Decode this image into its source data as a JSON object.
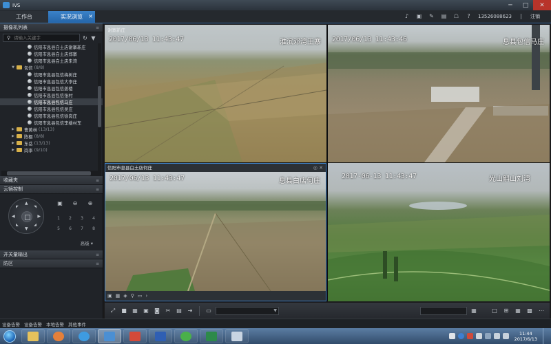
{
  "app": {
    "name": "IVS",
    "win_min": "─",
    "win_max": "□",
    "win_close": "✕"
  },
  "tabs": {
    "home": "工作台",
    "live": "实况浏览",
    "close": "×"
  },
  "user": {
    "phone": "13526088623",
    "logout": "注销"
  },
  "toolbar_icons": [
    "speaker-icon",
    "monitor-icon",
    "wrench-icon",
    "lock-icon",
    "network-icon",
    "help-icon"
  ],
  "left": {
    "camera_list_title": "摄像机列表",
    "search_placeholder": "请输入关键字",
    "tree": [
      {
        "kind": "cam",
        "indent": 3,
        "label": "信阳市息县白土店谢寨新庄"
      },
      {
        "kind": "cam",
        "indent": 3,
        "label": "信阳市息县白土店郑寨"
      },
      {
        "kind": "cam",
        "indent": 3,
        "label": "信阳市息县白土店朱湾"
      },
      {
        "kind": "folder",
        "indent": 1,
        "label": "包信",
        "count": "(8/8)",
        "open": true
      },
      {
        "kind": "cam",
        "indent": 3,
        "label": "信阳市息县包信梅树庄"
      },
      {
        "kind": "cam",
        "indent": 3,
        "label": "信阳市息县包信大李庄"
      },
      {
        "kind": "cam",
        "indent": 3,
        "label": "信阳市息县包信姜楼"
      },
      {
        "kind": "cam",
        "indent": 3,
        "label": "信阳市息县包信张村"
      },
      {
        "kind": "cam",
        "indent": 3,
        "label": "信阳市息县包信马庄",
        "selected": true
      },
      {
        "kind": "cam",
        "indent": 3,
        "label": "信阳市息县包信吴庄"
      },
      {
        "kind": "cam",
        "indent": 3,
        "label": "信阳市息县包信徐岗庄"
      },
      {
        "kind": "cam",
        "indent": 3,
        "label": "信阳市息县包信李楼村东"
      },
      {
        "kind": "folder",
        "indent": 1,
        "label": "曹黄林",
        "count": "(13/13)",
        "open": false
      },
      {
        "kind": "folder",
        "indent": 1,
        "label": "陈棚",
        "count": "(8/8)",
        "open": false
      },
      {
        "kind": "folder",
        "indent": 1,
        "label": "东岳",
        "count": "(13/13)",
        "open": false
      },
      {
        "kind": "folder",
        "indent": 1,
        "label": "岗李",
        "count": "(9/10)",
        "open": false
      }
    ],
    "favorites_title": "收藏夹",
    "ptz_title": "云镜控制",
    "ptz_numbers": [
      "1",
      "2",
      "3",
      "4",
      "5",
      "6",
      "7",
      "8"
    ],
    "ptz_advanced": "高级",
    "switch_output_title": "开关量输出",
    "defense_title": "防区"
  },
  "videos": {
    "c1": {
      "small": "谢寨新庄",
      "date": "2017/06/13 11:43:47",
      "place": "淮滨邓湾王寨"
    },
    "c2": {
      "date": "2017/06/13 11:43:46",
      "place": "息县包信马庄"
    },
    "c3": {
      "header": "信阳市息县白土店何庄",
      "date": "2017/06/13 11:43:47",
      "place": "息县白店何庄"
    },
    "c4": {
      "date": "2017-06-13 11:43:47",
      "place": "光山斛山刘湾"
    }
  },
  "alarm_tabs": [
    "设备告警",
    "设备告警",
    "本地告警",
    "其他事件"
  ],
  "clock": {
    "time": "11:44",
    "date": "2017/6/13"
  },
  "colors": {
    "accent": "#3b82c9",
    "taskbar": "#324c6b"
  }
}
